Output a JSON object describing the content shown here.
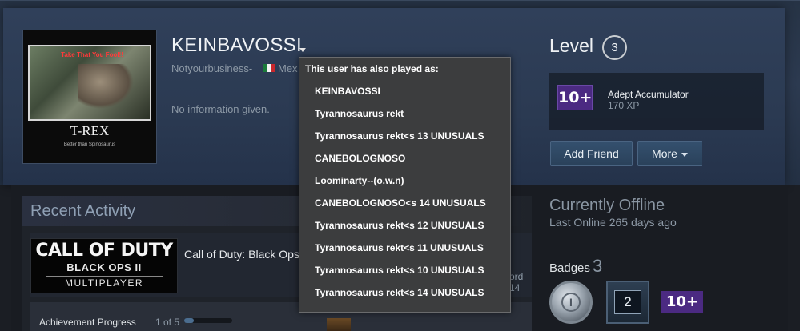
{
  "profile": {
    "persona_name": "KEINBAVOSSI",
    "real_name": "Notyourbusiness-",
    "country": "Mex",
    "summary": "No information given.",
    "avatar": {
      "caption_top": "Take That You Fool!!",
      "caption_big": "T-REX",
      "caption_small": "Better than Spinosaurus"
    }
  },
  "level": {
    "label": "Level",
    "value": "3"
  },
  "favorite_badge": {
    "icon_text": "10+",
    "name": "Adept Accumulator",
    "xp": "170 XP"
  },
  "actions": {
    "add_friend": "Add Friend",
    "more": "More"
  },
  "alias_popup": {
    "title": "This user has also played as:",
    "items": [
      "KEINBAVOSSI",
      "Tyrannosaurus rekt",
      "Tyrannosaurus rekt<s 13 UNUSUALS",
      "CANEBOLOGNOSO",
      "Loominarty--(o.w.n)",
      "CANEBOLOGNOSO<s 14 UNUSUALS",
      "Tyrannosaurus rekt<s 12 UNUSUALS",
      "Tyrannosaurus rekt<s 11 UNUSUALS",
      "Tyrannosaurus rekt<s 10 UNUSUALS",
      "Tyrannosaurus rekt<s 14 UNUSUALS"
    ]
  },
  "recent_activity": {
    "title": "Recent Activity",
    "game": {
      "capsule_line1": "CALL OF DUTY",
      "capsule_line2": "BLACK OPS II",
      "capsule_line3": "MULTIPLAYER",
      "name": "Call of Duty: Black Ops",
      "stats_line1": "ord",
      "stats_line2": "14"
    },
    "achievement": {
      "label": "Achievement Progress",
      "count": "1 of 5",
      "progress_fraction": 0.2
    }
  },
  "status": {
    "state": "Currently Offline",
    "last_online": "Last Online 265 days ago"
  },
  "badges": {
    "label": "Badges",
    "count": "3",
    "items": [
      {
        "icon": "coin-badge-icon"
      },
      {
        "icon": "level-2-badge-icon",
        "text": "2"
      },
      {
        "icon": "accumulator-badge-icon",
        "text": "10+"
      }
    ]
  },
  "colors": {
    "accent_purple": "#4b2a82",
    "header_blue": "#2c3a50",
    "popup_bg": "#3c3d3e"
  }
}
